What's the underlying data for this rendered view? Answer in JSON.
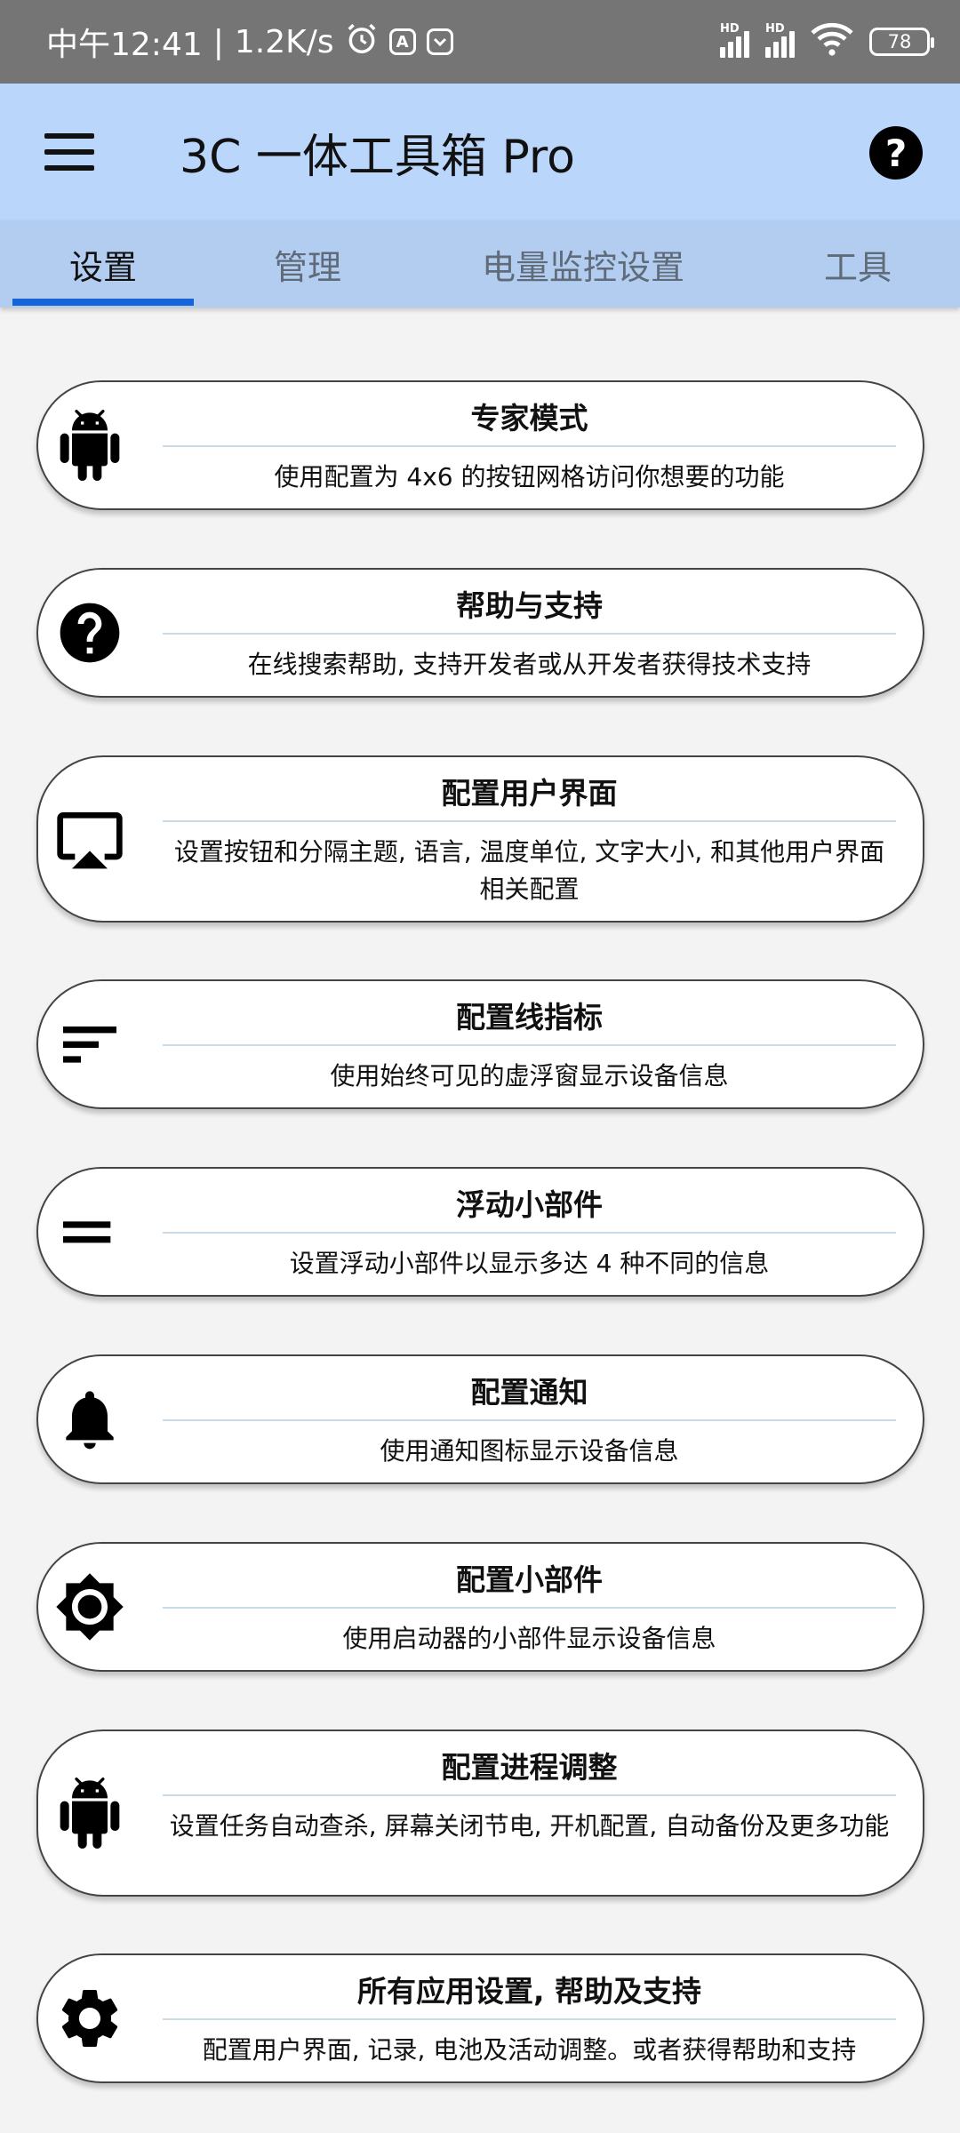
{
  "status_bar": {
    "time": "中午12:41",
    "separator": "|",
    "speed": "1.2K/s",
    "alarm_icon": "alarm-icon",
    "notif_a": "A",
    "hd1": "HD",
    "hd2": "HD",
    "battery": "78"
  },
  "app_bar": {
    "title": "3C 一体工具箱 Pro",
    "help": "?"
  },
  "tabs": [
    {
      "label": "设置"
    },
    {
      "label": "管理"
    },
    {
      "label": "电量监控设置"
    },
    {
      "label": "工具"
    }
  ],
  "cards": [
    {
      "title": "专家模式",
      "desc": "使用配置为 4x6 的按钮网格访问你想要的功能",
      "icon": "android-icon"
    },
    {
      "title": "帮助与支持",
      "desc": "在线搜索帮助, 支持开发者或从开发者获得技术支持",
      "icon": "help-circle-icon"
    },
    {
      "title": "配置用户界面",
      "desc": "设置按钮和分隔主题, 语言, 温度单位, 文字大小, 和其他用户界面相关配置",
      "icon": "cast-screen-icon"
    },
    {
      "title": "配置线指标",
      "desc": "使用始终可见的虚浮窗显示设备信息",
      "icon": "sort-lines-icon"
    },
    {
      "title": "浮动小部件",
      "desc": "设置浮动小部件以显示多达 4 种不同的信息",
      "icon": "equals-lines-icon"
    },
    {
      "title": "配置通知",
      "desc": "使用通知图标显示设备信息",
      "icon": "bell-icon"
    },
    {
      "title": "配置小部件",
      "desc": "使用启动器的小部件显示设备信息",
      "icon": "brightness-icon"
    },
    {
      "title": "配置进程调整",
      "desc": "设置任务自动查杀, 屏幕关闭节电, 开机配置, 自动备份及更多功能",
      "icon": "android-icon"
    },
    {
      "title": "所有应用设置, 帮助及支持",
      "desc": "配置用户界面, 记录, 电池及活动调整。或者获得帮助和支持",
      "icon": "gear-icon"
    }
  ]
}
